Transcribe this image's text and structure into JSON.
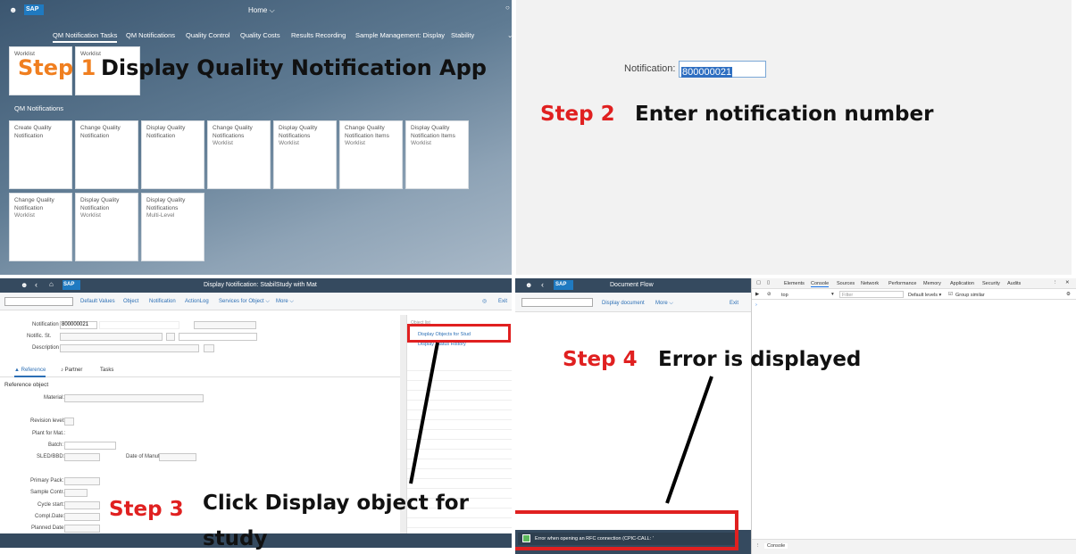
{
  "step1": {
    "home_label": "Home ⌵",
    "tabs": [
      "QM Notification Tasks",
      "QM Notifications",
      "Quality Control",
      "Quality Costs",
      "Results Recording",
      "Sample Management: Display",
      "Stability"
    ],
    "worklist_tiles": [
      "Worklist",
      "Worklist"
    ],
    "group_title": "QM Notifications",
    "tiles": [
      {
        "title": "Create Quality Notification",
        "sub": ""
      },
      {
        "title": "Change Quality Notification",
        "sub": ""
      },
      {
        "title": "Display Quality Notification",
        "sub": ""
      },
      {
        "title": "Change Quality Notifications",
        "sub": "Worklist"
      },
      {
        "title": "Display Quality Notifications",
        "sub": "Worklist"
      },
      {
        "title": "Change Quality Notification Items",
        "sub": "Worklist"
      },
      {
        "title": "Display Quality Notification Items",
        "sub": "Worklist"
      },
      {
        "title": "Change Quality Notification",
        "sub": "Worklist"
      },
      {
        "title": "Display Quality Notification",
        "sub": "Worklist"
      },
      {
        "title": "Display Quality Notifications",
        "sub": "Multi-Level"
      }
    ],
    "step_word": "Step",
    "step_num": "1",
    "caption": "Display Quality Notification App"
  },
  "step2": {
    "field_label": "Notification:",
    "field_value": "800000021",
    "step_label": "Step 2",
    "caption": "Enter notification number"
  },
  "step3": {
    "title": "Display Notification: StabilStudy with Mat",
    "toolbar": [
      "Default Values",
      "Object",
      "Notification",
      "ActionLog",
      "Services for Object ⌵",
      "More ⌵"
    ],
    "exit": "Exit",
    "notification_label": "Notification",
    "notification_value": "800000021",
    "notific_st_label": "Notific. St.",
    "description_label": "Description",
    "tabs": [
      "Reference",
      "Partner",
      "Tasks"
    ],
    "ref_object": "Reference object",
    "fields": [
      "Material:",
      "Revision level:",
      "Plant for Mat.:",
      "Batch:",
      "SLED/BBD:",
      "Primary Pack:",
      "Sample Contr.:",
      "Cycle start:",
      "Compl.Date:",
      "Planned Date:"
    ],
    "date_manuf": "Date of Manuf.:",
    "side_header": "Object list",
    "side_items": [
      "Display Objects for Stud",
      "Display Status History"
    ],
    "step_label": "Step 3",
    "caption_line1": "Click Display object for",
    "caption_line2": "study"
  },
  "step4": {
    "title": "Document Flow",
    "toolbar": [
      "Display document",
      "More ⌵"
    ],
    "exit": "Exit",
    "devtools_tabs": [
      "Elements",
      "Console",
      "Sources",
      "Network",
      "Performance",
      "Memory",
      "Application",
      "Security",
      "Audits"
    ],
    "context": "top",
    "filter_placeholder": "Filter",
    "levels": "Default levels ▾",
    "group_similar": "Group similar",
    "console_tab": "Console",
    "error_msg": "Error when opening an RFC connection (CPIC-CALL: '",
    "step_label": "Step 4",
    "caption": "Error is displayed"
  },
  "colors": {
    "step_red": "#e02020",
    "step_orange": "#f07f20",
    "highlight": "#e02020",
    "shell": "#354a5f"
  }
}
